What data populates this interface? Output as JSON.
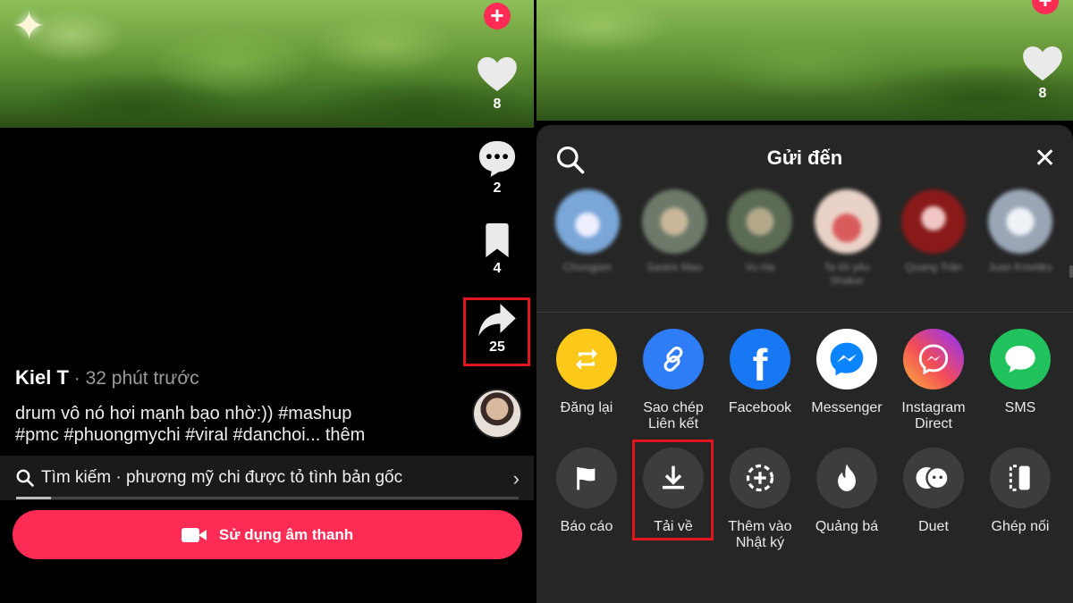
{
  "left": {
    "stats": {
      "likes": "8",
      "comments": "2",
      "saves": "4",
      "shares": "25"
    },
    "author": "Kiel T",
    "time": " · 32 phút trước",
    "caption_line1": "drum vô nó hơi mạnh bạo nhờ:)) #mashup",
    "caption_line2": "#pmc #phuongmychi #viral #danchoi... thêm",
    "search_text": "Tìm kiếm · phương mỹ chi được tỏ tình bản gốc",
    "use_sound_label": "Sử dụng âm thanh",
    "progress": 0.07,
    "accent": "#fe2c55",
    "highlight": "#e0161e"
  },
  "right": {
    "likes": "8",
    "sheet_title": "Gửi đến",
    "friends": [
      {
        "name": "Chongjam"
      },
      {
        "name": "Saskis Mau"
      },
      {
        "name": "Vu Ha"
      },
      {
        "name": "Ta tôi yêu Shaker"
      },
      {
        "name": "Quang Trần"
      },
      {
        "name": "Juan Kmeliks"
      }
    ],
    "share_row": [
      {
        "label": "Đăng lại",
        "icon": "repost-icon",
        "color": "#fcc91a"
      },
      {
        "label": "Sao chép Liên kết",
        "icon": "link-icon",
        "color": "#2e7cf6"
      },
      {
        "label": "Facebook",
        "icon": "facebook-icon",
        "color": "#1877f2"
      },
      {
        "label": "Messenger",
        "icon": "messenger-icon",
        "color": "#ffffff"
      },
      {
        "label": "Instagram Direct",
        "icon": "instagram-direct-icon",
        "color": "#d6249f"
      },
      {
        "label": "SMS",
        "icon": "sms-icon",
        "color": "#21c25e"
      }
    ],
    "action_row": [
      {
        "label": "Báo cáo",
        "icon": "flag-icon"
      },
      {
        "label": "Tải về",
        "icon": "download-icon"
      },
      {
        "label": "Thêm vào Nhật ký",
        "icon": "add-story-icon"
      },
      {
        "label": "Quảng bá",
        "icon": "flame-icon"
      },
      {
        "label": "Duet",
        "icon": "duet-icon"
      },
      {
        "label": "Ghép nối",
        "icon": "stitch-icon"
      }
    ]
  }
}
